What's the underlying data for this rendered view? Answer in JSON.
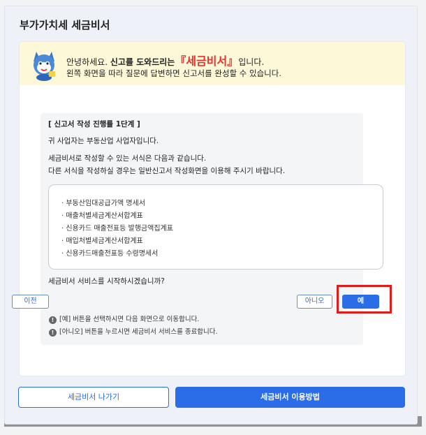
{
  "dialog": {
    "title": "부가가치세 세금비서",
    "greeting": {
      "prefix": "안녕하세요. ",
      "bold": "신고를 도와드리는",
      "brand": "『세금비서』",
      "suffix": "입니다.",
      "line2": "왼쪽 화면을 따라 질문에 답변하면 신고서를 완성할 수 있습니다."
    },
    "step": {
      "title": "[ 신고서 작성 진행률 1단계 ]",
      "business_line": "귀 사업자는 부동산업 사업자입니다.",
      "forms_intro_1": "세금비서로 작성할 수 있는 서식은 다음과 같습니다.",
      "forms_intro_2": "다른 서식을 작성하실 경우는 일반신고서 작성화면을 이용해 주시기 바랍니다.",
      "forms": [
        "· 부동산임대공급가액 명세서",
        "· 매출처별세금계산서합계표",
        "· 신용카드 매출전표등 발행금액집계표",
        "· 매입처별세금계산서합계표",
        "· 신용카드매출전표등 수령명세서"
      ],
      "question": "세금비서 서비스를 시작하시겠습니까?",
      "buttons": {
        "prev": "이전",
        "no": "아니오",
        "yes": "예"
      },
      "info": [
        "[예] 버튼을 선택하시면 다음 화면으로 이동합니다.",
        "[아니오] 버튼을 누르시면 세금비서 서비스를 종료합니다."
      ]
    },
    "footer": {
      "exit": "세금비서 나가기",
      "howto": "세금비서 이용방법"
    }
  },
  "colors": {
    "accent": "#2b6de6",
    "brand_red": "#e8322f",
    "highlight": "#e11a1a",
    "greeting_bg": "#fdf9d8"
  },
  "icons": {
    "mascot": "tax-secretary-mascot-icon",
    "info": "info-circle-icon"
  }
}
